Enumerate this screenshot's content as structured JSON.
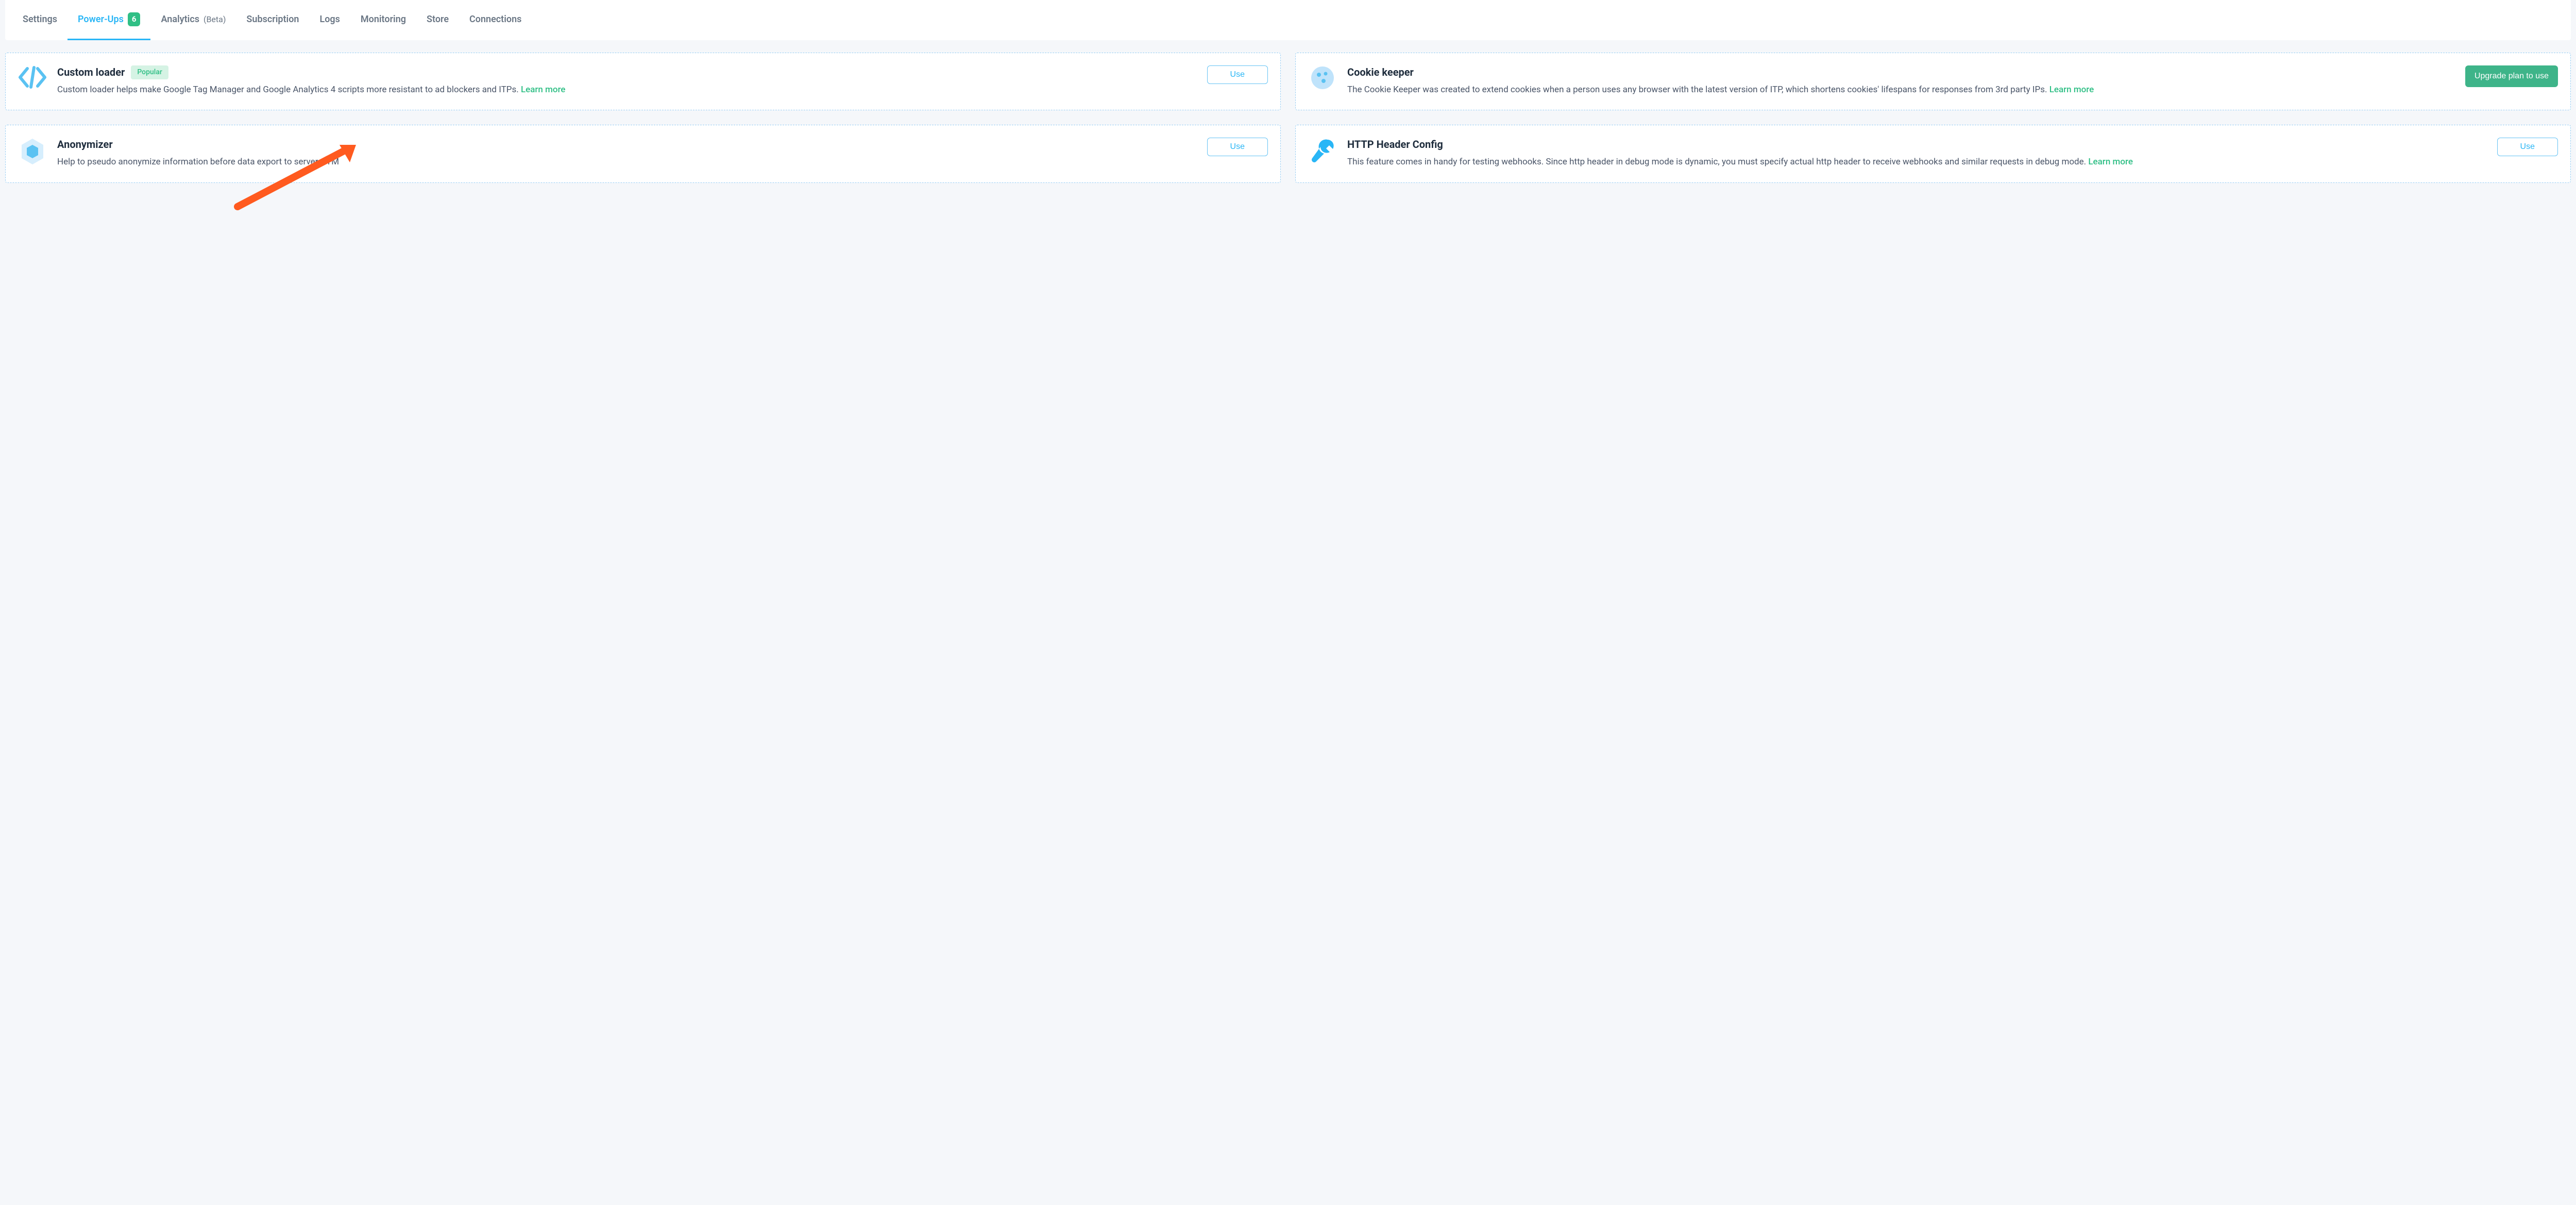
{
  "tabs": {
    "items": [
      {
        "label": "Settings"
      },
      {
        "label": "Power-Ups",
        "count": "6",
        "active": true
      },
      {
        "label": "Analytics",
        "suffix": "(Beta)"
      },
      {
        "label": "Subscription"
      },
      {
        "label": "Logs"
      },
      {
        "label": "Monitoring"
      },
      {
        "label": "Store"
      },
      {
        "label": "Connections"
      }
    ]
  },
  "badges": {
    "popular": "Popular"
  },
  "buttons": {
    "use": "Use",
    "upgrade": "Upgrade plan to use"
  },
  "links": {
    "learn_more": "Learn more"
  },
  "cards": {
    "custom_loader": {
      "title": "Custom loader",
      "description": "Custom loader helps make Google Tag Manager and Google Analytics 4 scripts more resistant to ad blockers and ITPs. "
    },
    "cookie_keeper": {
      "title": "Cookie keeper",
      "description": "The Cookie Keeper was created to extend cookies when a person uses any browser with the latest version of ITP, which shortens cookies' lifespans for responses from 3rd party IPs. "
    },
    "anonymizer": {
      "title": "Anonymizer",
      "description": "Help to pseudo anonymize information before data export to server GTM"
    },
    "http_header": {
      "title": "HTTP Header Config",
      "description": "This feature comes in handy for testing webhooks. Since http header in debug mode is dynamic, you must specify actual http header to receive webhooks and similar requests in debug mode. "
    }
  }
}
